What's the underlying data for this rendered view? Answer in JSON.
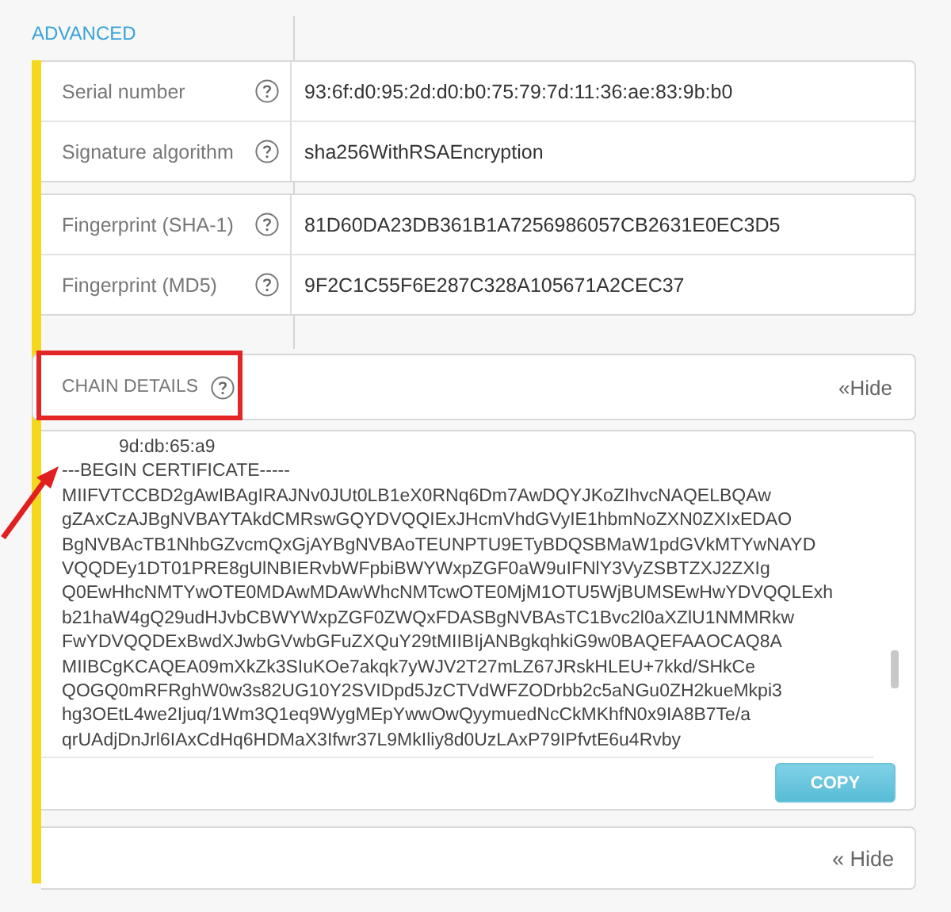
{
  "section_title": "ADVANCED",
  "groups": [
    {
      "rows": [
        {
          "label": "Serial number",
          "value": "93:6f:d0:95:2d:d0:b0:75:79:7d:11:36:ae:83:9b:b0"
        },
        {
          "label": "Signature algorithm",
          "value": "sha256WithRSAEncryption"
        }
      ]
    },
    {
      "rows": [
        {
          "label": "Fingerprint (SHA-1)",
          "value": "81D60DA23DB361B1A7256986057CB2631E0EC3D5"
        },
        {
          "label": "Fingerprint (MD5)",
          "value": "9F2C1C55F6E287C328A105671A2CEC37"
        }
      ]
    }
  ],
  "chain_details": {
    "title": "CHAIN DETAILS",
    "hide_link": "«Hide",
    "highlighted": true
  },
  "certificate": {
    "lines": [
      {
        "text": "9d:db:65:a9",
        "indented": true
      },
      {
        "text": "---BEGIN CERTIFICATE-----",
        "indented": false
      },
      {
        "text": "MIIFVTCCBD2gAwIBAgIRAJNv0JUt0LB1eX0RNq6Dm7AwDQYJKoZIhvcNAQELBQAw",
        "indented": false
      },
      {
        "text": "gZAxCzAJBgNVBAYTAkdCMRswGQYDVQQIExJHcmVhdGVyIE1hbmNoZXN0ZXIxEDAO",
        "indented": false
      },
      {
        "text": "BgNVBAcTB1NhbGZvcmQxGjAYBgNVBAoTEUNPTU9ETyBDQSBMaW1pdGVkMTYwNAYD",
        "indented": false
      },
      {
        "text": "VQQDEy1DT01PRE8gUlNBIERvbWFpbiBWYWxpZGF0aW9uIFNlY3VyZSBTZXJ2ZXIg",
        "indented": false
      },
      {
        "text": "Q0EwHhcNMTYwOTE0MDAwMDAwWhcNMTcwOTE0MjM1OTU5WjBUMSEwHwYDVQQLExh",
        "indented": false
      },
      {
        "text": "b21haW4gQ29udHJvbCBWYWxpZGF0ZWQxFDASBgNVBAsTC1Bvc2l0aXZlU1NMMRkw",
        "indented": false
      },
      {
        "text": "FwYDVQQDExBwdXJwbGVwbGFuZXQuY29tMIIBIjANBgkqhkiG9w0BAQEFAAOCAQ8A",
        "indented": false
      },
      {
        "text": "MIIBCgKCAQEA09mXkZk3SIuKOe7akqk7yWJV2T27mLZ67JRskHLEU+7kkd/SHkCe",
        "indented": false
      },
      {
        "text": "QOGQ0mRFRghW0w3s82UG10Y2SVIDpd5JzCTVdWFZODrbb2c5aNGu0ZH2kueMkpi3",
        "indented": false
      },
      {
        "text": "hg3OEtL4we2Ijuq/1Wm3Q1eq9WygMEpYwwOwQyymuedNcCkMKhfN0x9IA8B7Te/a",
        "indented": false
      },
      {
        "text": "qrUAdjDnJrl6IAxCdHq6HDMaX3Ifwr37L9MkIliy8d0UzLAxP79IPfvtE6u4Rvby",
        "indented": false
      }
    ],
    "copy_button": "COPY"
  },
  "footer_hide_link": "« Hide"
}
